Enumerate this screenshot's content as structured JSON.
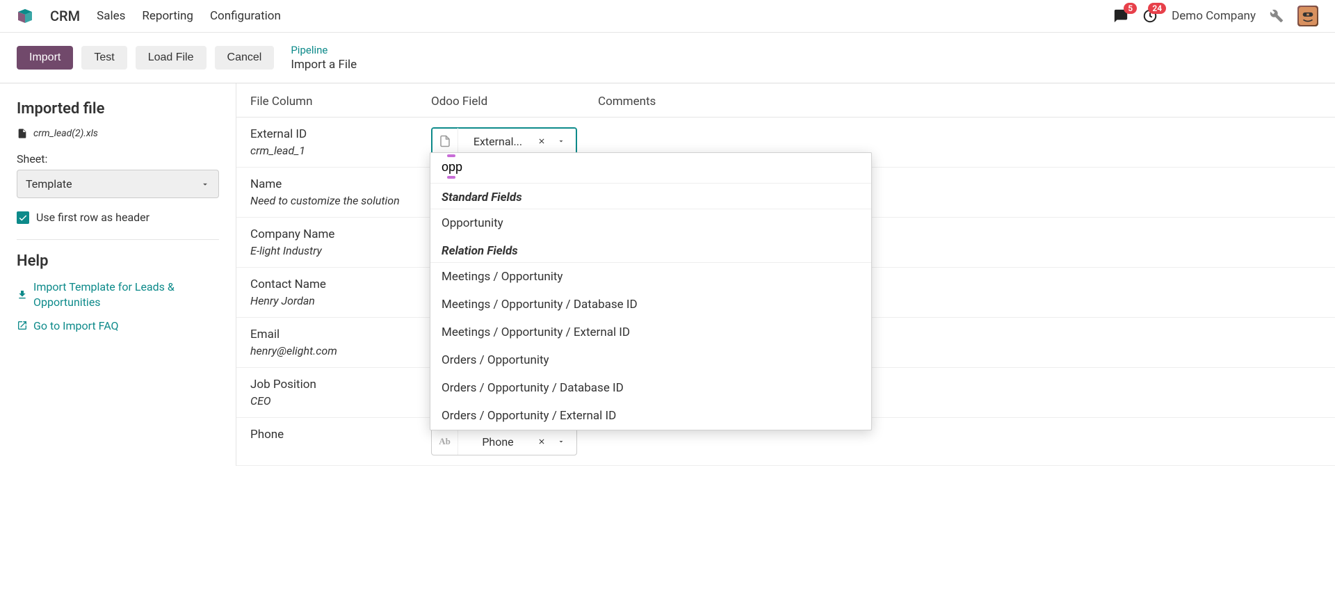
{
  "nav": {
    "app": "CRM",
    "links": [
      "Sales",
      "Reporting",
      "Configuration"
    ],
    "company": "Demo Company",
    "msg_badge": "5",
    "clock_badge": "24"
  },
  "toolbar": {
    "import": "Import",
    "test": "Test",
    "load": "Load File",
    "cancel": "Cancel",
    "breadcrumb_link": "Pipeline",
    "breadcrumb_current": "Import a File"
  },
  "side": {
    "imported_title": "Imported file",
    "filename": "crm_lead(2).xls",
    "sheet_label": "Sheet:",
    "sheet_value": "Template",
    "use_header": "Use first row as header",
    "help_title": "Help",
    "help_link1": "Import Template for Leads & Opportunities",
    "help_link2": "Go to Import FAQ"
  },
  "table": {
    "h1": "File Column",
    "h2": "Odoo Field",
    "h3": "Comments",
    "rows": [
      {
        "label": "External ID",
        "sample": "crm_lead_1",
        "selected": "External...",
        "active": true,
        "icon": "file"
      },
      {
        "label": "Name",
        "sample": "Need to customize the solution",
        "selected": "",
        "active": false,
        "icon": ""
      },
      {
        "label": "Company Name",
        "sample": "E-light Industry",
        "selected": "",
        "active": false,
        "icon": ""
      },
      {
        "label": "Contact Name",
        "sample": "Henry Jordan",
        "selected": "",
        "active": false,
        "icon": ""
      },
      {
        "label": "Email",
        "sample": "henry@elight.com",
        "selected": "",
        "active": false,
        "icon": ""
      },
      {
        "label": "Job Position",
        "sample": "CEO",
        "selected": "",
        "active": false,
        "icon": ""
      },
      {
        "label": "Phone",
        "sample": "",
        "selected": "Phone",
        "active": false,
        "icon": "ab"
      }
    ]
  },
  "dropdown": {
    "search": "opp",
    "group1": "Standard Fields",
    "items1": [
      "Opportunity"
    ],
    "group2": "Relation Fields",
    "items2": [
      "Meetings / Opportunity",
      "Meetings / Opportunity / Database ID",
      "Meetings / Opportunity / External ID",
      "Orders / Opportunity",
      "Orders / Opportunity / Database ID",
      "Orders / Opportunity / External ID"
    ]
  }
}
